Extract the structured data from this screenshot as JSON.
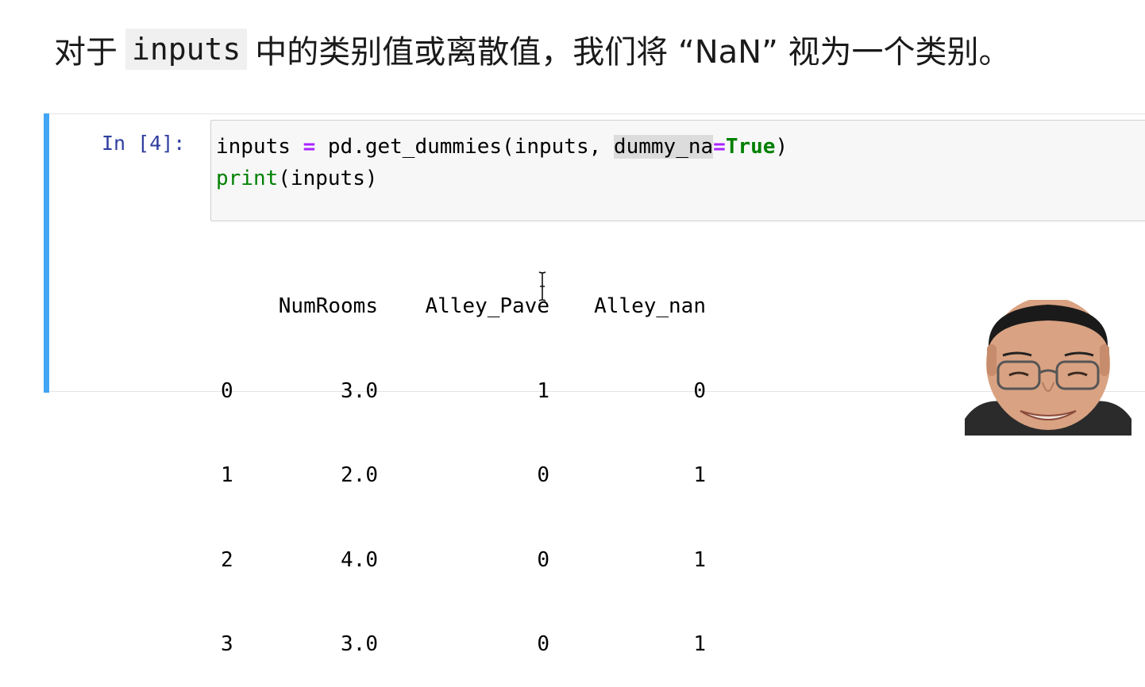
{
  "heading": {
    "prefix": "对于",
    "code": "inputs",
    "suffix": "中的类别值或离散值，我们将 “NaN” 视为一个类别。"
  },
  "cell": {
    "prompt": "In [4]:",
    "line1": {
      "t1": "inputs ",
      "op1": "=",
      "t2": " pd.get_dummies(inputs, ",
      "hl": "dummy_na",
      "op2": "=",
      "kw": "True",
      "t3": ")"
    },
    "line2": {
      "builtin": "print",
      "rest": "(inputs)"
    }
  },
  "output": {
    "columns": [
      "",
      "NumRooms",
      "Alley_Pave",
      "Alley_nan"
    ],
    "rows": [
      [
        "0",
        "3.0",
        "1",
        "0"
      ],
      [
        "1",
        "2.0",
        "0",
        "1"
      ],
      [
        "2",
        "4.0",
        "0",
        "1"
      ],
      [
        "3",
        "3.0",
        "0",
        "1"
      ]
    ]
  },
  "icons": {
    "cursor": "text-cursor-icon",
    "presenter": "presenter-webcam-avatar"
  },
  "colors": {
    "cell_bar": "#42a5f5",
    "prompt": "#303f9f",
    "keyword": "#008000",
    "operator": "#aa22ff"
  }
}
